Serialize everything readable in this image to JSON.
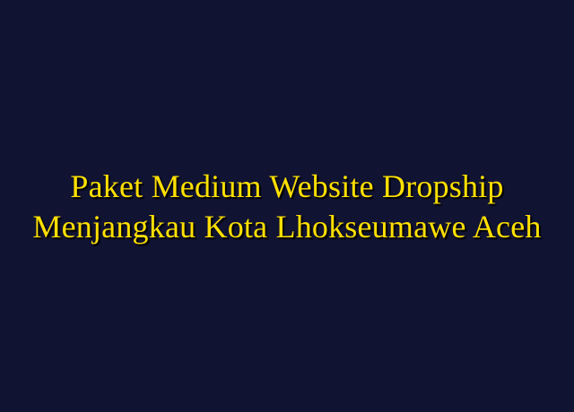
{
  "title": {
    "line1": "Paket Medium Website Dropship",
    "line2": "Menjangkau Kota Lhokseumawe Aceh"
  },
  "colors": {
    "background": "#111333",
    "text": "#ffe000"
  }
}
